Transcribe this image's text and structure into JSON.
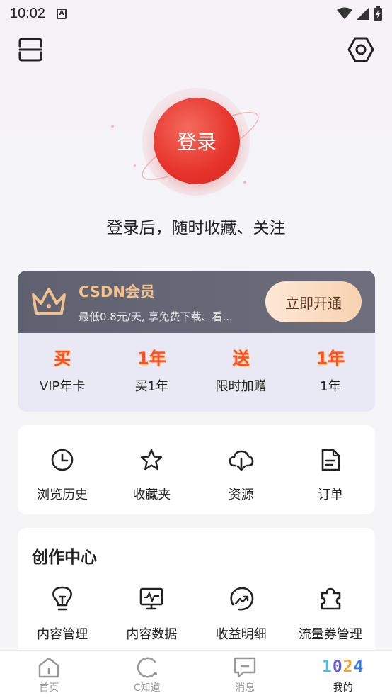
{
  "status_bar": {
    "time": "10:02",
    "notification_icon": "A"
  },
  "header": {
    "scan_icon": "scan-icon",
    "settings_icon": "settings-icon"
  },
  "login": {
    "button_label": "登录",
    "hint": "登录后，随时收藏、关注"
  },
  "vip": {
    "title": "CSDN会员",
    "subtitle": "最低0.8元/天, 享免费下载、看...",
    "open_label": "立即开通",
    "perks": [
      {
        "badge": "买",
        "label": "VIP年卡"
      },
      {
        "badge": "1年",
        "label": "买1年"
      },
      {
        "badge": "送",
        "label": "限时加赠"
      },
      {
        "badge": "1年",
        "label": "1年"
      }
    ]
  },
  "quick": {
    "items": [
      {
        "label": "浏览历史",
        "icon": "clock-icon"
      },
      {
        "label": "收藏夹",
        "icon": "star-icon"
      },
      {
        "label": "资源",
        "icon": "cloud-download-icon"
      },
      {
        "label": "订单",
        "icon": "document-icon"
      }
    ]
  },
  "create": {
    "title": "创作中心",
    "items": [
      {
        "label": "内容管理",
        "icon": "lightbulb-icon"
      },
      {
        "label": "内容数据",
        "icon": "monitor-chart-icon"
      },
      {
        "label": "收益明细",
        "icon": "earnings-icon"
      },
      {
        "label": "流量券管理",
        "icon": "ticket-icon"
      }
    ]
  },
  "tabbar": {
    "tabs": [
      {
        "label": "首页",
        "icon": "home-icon"
      },
      {
        "label": "C知道",
        "icon": "c-icon"
      },
      {
        "label": "消息",
        "icon": "message-icon"
      },
      {
        "label": "我的",
        "icon": "1024-logo",
        "logo_text": "1024"
      }
    ],
    "active": "我的"
  },
  "colors": {
    "accent_red": "#e6332a",
    "vip_gold": "#f4c28a",
    "badge_red": "#ff4c2e"
  }
}
